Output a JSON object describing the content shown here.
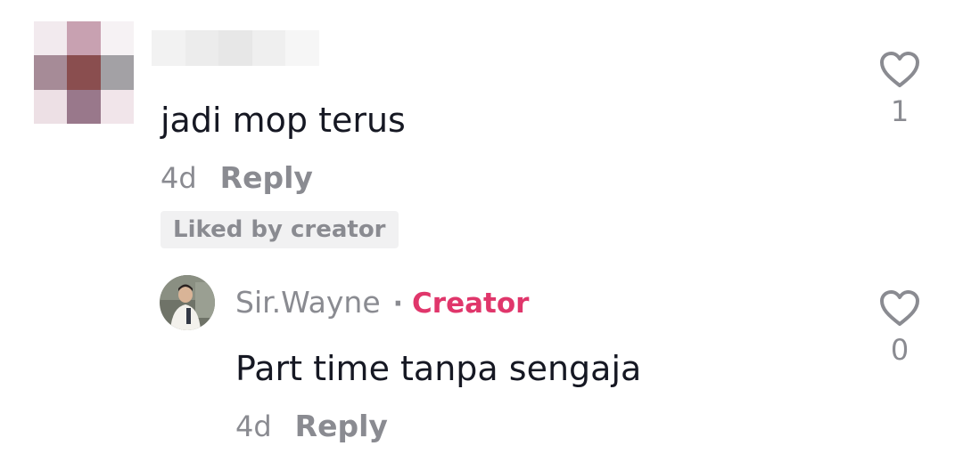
{
  "comment": {
    "avatar_pixels": [
      "#f2eaee",
      "#c8a1b1",
      "#f6f2f4",
      "#a68b97",
      "#8a4e4f",
      "#a3a1a5",
      "#ede0e5",
      "#99788b",
      "#f1e5ea"
    ],
    "username_pixels": [
      "#f2f2f2",
      "#ececec",
      "#e7e7e7",
      "#efefef",
      "#f6f6f6"
    ],
    "text": "jadi mop terus",
    "time": "4d",
    "reply_label": "Reply",
    "liked_by_creator_label": "Liked by creator",
    "like_icon": "heart-outline-icon",
    "like_count": "1"
  },
  "reply": {
    "username": "Sir.Wayne",
    "separator": "·",
    "creator_label": "Creator",
    "text": "Part time tanpa sengaja",
    "time": "4d",
    "reply_label": "Reply",
    "like_icon": "heart-outline-icon",
    "like_count": "0"
  },
  "colors": {
    "creator": "#e0366b",
    "secondary_text": "#8a8b91",
    "primary_text": "#161823"
  }
}
